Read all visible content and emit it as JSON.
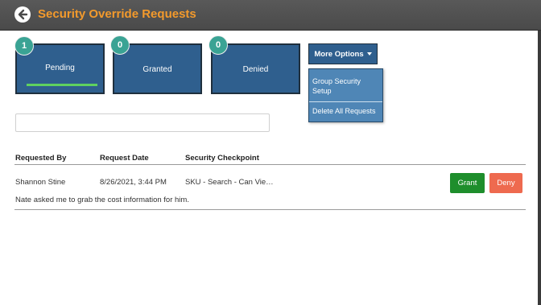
{
  "header": {
    "title": "Security Override Requests",
    "back_icon": "back-arrow-circle-icon",
    "title_color": "#f39a2c"
  },
  "tiles": [
    {
      "label": "Pending",
      "count": "1",
      "selected": true
    },
    {
      "label": "Granted",
      "count": "0",
      "selected": false
    },
    {
      "label": "Denied",
      "count": "0",
      "selected": false
    }
  ],
  "more_options": {
    "label": "More Options",
    "menu": [
      "Group Security Setup",
      "Delete All Requests"
    ]
  },
  "search": {
    "value": "",
    "placeholder": ""
  },
  "table": {
    "columns": [
      "Requested By",
      "Request Date",
      "Security Checkpoint"
    ],
    "rows": [
      {
        "requested_by": "Shannon Stine",
        "request_date": "8/26/2021, 3:44 PM",
        "checkpoint": "SKU - Search - Can Vie…",
        "note": "Nate asked me to grab the cost information for him.",
        "grant_label": "Grant",
        "deny_label": "Deny"
      }
    ]
  },
  "colors": {
    "tile_bg": "#2f5f8e",
    "badge": "#3aa394",
    "grant": "#1e8e2c",
    "deny": "#ee6a4f"
  }
}
